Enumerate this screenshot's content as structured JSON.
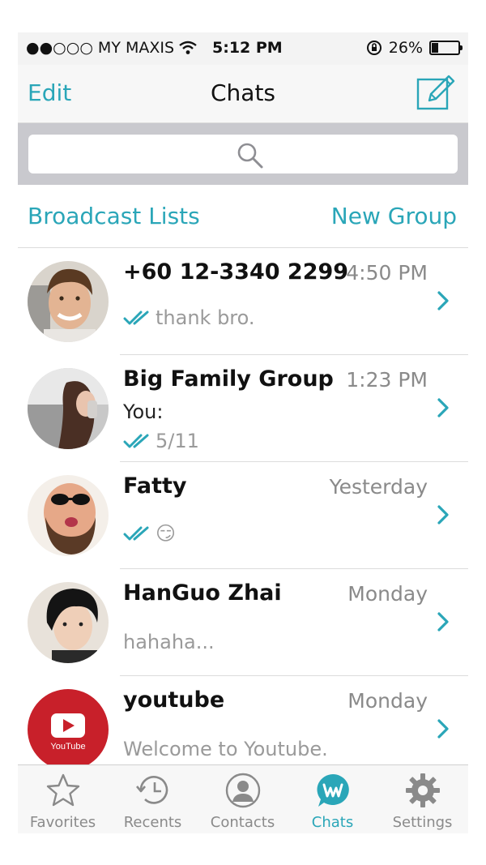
{
  "status_bar": {
    "carrier": "●●○○○ MY MAXIS",
    "time": "5:12 PM",
    "battery": "26%",
    "battery_level": 0.26
  },
  "nav": {
    "edit_label": "Edit",
    "title": "Chats",
    "compose_icon": "compose-icon"
  },
  "search": {
    "placeholder": ""
  },
  "links": {
    "broadcast": "Broadcast Lists",
    "new_group": "New Group"
  },
  "chats": [
    {
      "name": "+60 12-3340 2299",
      "time": "4:50 PM",
      "preview": "thank bro.",
      "read_ticks": true
    },
    {
      "name": "Big Family Group",
      "time": "1:23 PM",
      "sender": "You:",
      "preview": "5/11",
      "read_ticks": true
    },
    {
      "name": "Fatty",
      "time": "Yesterday",
      "preview": "😏",
      "read_ticks": true
    },
    {
      "name": "HanGuo Zhai",
      "time": "Monday",
      "preview": "hahaha...",
      "read_ticks": false
    },
    {
      "name": "youtube",
      "time": "Monday",
      "preview": "Welcome to Youtube.",
      "read_ticks": false,
      "avatar_text": "YouTube"
    }
  ],
  "tabs": [
    {
      "label": "Favorites",
      "icon": "star-icon"
    },
    {
      "label": "Recents",
      "icon": "clock-icon"
    },
    {
      "label": "Contacts",
      "icon": "person-icon"
    },
    {
      "label": "Chats",
      "icon": "chat-bubble-icon",
      "active": true
    },
    {
      "label": "Settings",
      "icon": "gear-icon"
    }
  ],
  "colors": {
    "accent": "#2aa6b8",
    "youtube_red": "#c8202a"
  }
}
